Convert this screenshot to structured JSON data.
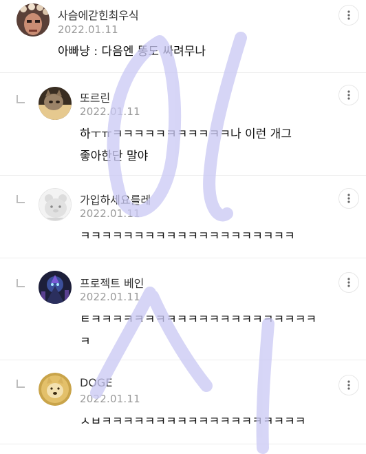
{
  "comments": [
    {
      "author": "사슴에갇힌최우식",
      "date": "2022.01.11",
      "text": "아빠냥 : 다음엔 똥도 싸려무나",
      "avatar": "person-with-flower-crown"
    },
    {
      "author": "또르린",
      "date": "2022.01.11",
      "text": "하ㅜㅠㅋㅋㅋㅋㅋㅋㅋㅋㅋㅋㅋ나 이런 개그\n좋아한단 말야",
      "avatar": "cat-photo"
    },
    {
      "author": "가입하세요를레",
      "date": "2022.01.11",
      "text": "ㅋㅋㅋㅋㅋㅋㅋㅋㅋㅋㅋㅋㅋㅋㅋㅋㅋㅋㅋㅋ",
      "avatar": "default-bear"
    },
    {
      "author": "프로젝트 베인",
      "date": "2022.01.11",
      "text": "ㅌㅋㅋㅋㅋㅋㅋㅋㅋㅋㅋㅋㅋㅋㅋㅋㅋㅋㅋㅋㅋㅋ\nㅋ",
      "avatar": "game-character"
    },
    {
      "author": "DOGE",
      "date": "2022.01.11",
      "text": "ㅅㅂㅋㅋㅋㅋㅋㅋㅋㅋㅋㅋㅋㅋㅋㅋㅋㅋㅋㅋㅋ",
      "avatar": "doge-coin"
    }
  ],
  "watermark_color": "#c9c8f4"
}
